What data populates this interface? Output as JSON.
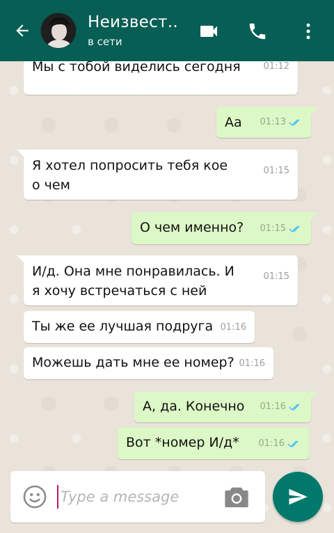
{
  "header": {
    "contact_name": "Неизвест..",
    "status": "в сети",
    "colors": {
      "bar": "#075e54"
    },
    "icons": [
      "back-arrow-icon",
      "video-call-icon",
      "phone-icon",
      "more-options-icon"
    ]
  },
  "messages": [
    {
      "dir": "in",
      "text": "Да. Я друг Тэхена — ЧиМин. Мы с тобой виделись сегодня",
      "time": "01:12"
    },
    {
      "dir": "out",
      "text": "Аа",
      "time": "01:13",
      "read": true
    },
    {
      "dir": "in",
      "text": "Я хотел попросить тебя кое о чем",
      "time": "01:15"
    },
    {
      "dir": "out",
      "text": "О чем именно?",
      "time": "01:15",
      "read": true
    },
    {
      "dir": "in",
      "text": "И/д. Она мне понравилась. И я хочу встречаться с ней",
      "time": "01:15"
    },
    {
      "dir": "in",
      "text": "Ты же ее лучшая подруга",
      "time": "01:16"
    },
    {
      "dir": "in",
      "text": "Можешь дать мне ее номер?",
      "time": "01:16"
    },
    {
      "dir": "out",
      "text": "А, да. Конечно",
      "time": "01:16",
      "read": true
    },
    {
      "dir": "out",
      "text": "Вот *номер И/д*",
      "time": "01:16",
      "read": true
    }
  ],
  "input": {
    "placeholder": "Type a message",
    "value": ""
  },
  "colors": {
    "incoming_bubble": "#ffffff",
    "outgoing_bubble": "#dcf8c6",
    "read_tick": "#4fc3f7",
    "send_button": "#00796b"
  }
}
